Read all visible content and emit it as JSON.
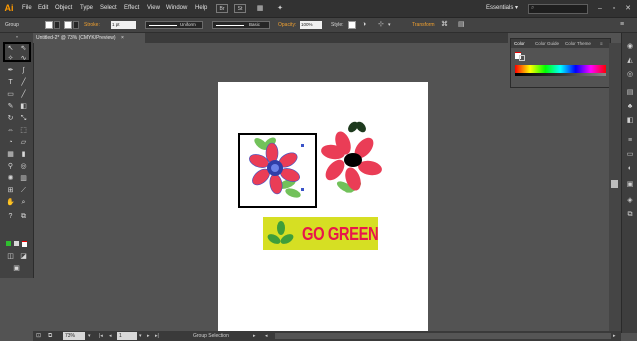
{
  "app": {
    "logo": "Ai"
  },
  "menu": [
    "File",
    "Edit",
    "Object",
    "Type",
    "Select",
    "Effect",
    "View",
    "Window",
    "Help"
  ],
  "menu_icons": {
    "br": "Br",
    "st": "St"
  },
  "workspace": {
    "label": "Essentials",
    "search_placeholder": ""
  },
  "control_bar": {
    "selection": "Group",
    "stroke_label": "Stroke:",
    "stroke_weight": "1 pt",
    "profile": "Uniform",
    "brush": "Basic",
    "opacity_label": "Opacity:",
    "opacity_value": "100%",
    "style_label": "Style:",
    "transform_label": "Transform"
  },
  "document_tab": {
    "title": "Untitled-2* @ 73% (CMYK/Preview)",
    "close": "×"
  },
  "color_panel": {
    "tabs": [
      "Color",
      "Color Guide",
      "Color Theme"
    ]
  },
  "status_bar": {
    "zoom": "73%",
    "page": "1",
    "tool": "Group Selection"
  },
  "artwork": {
    "banner_text": "GO GREEN"
  },
  "colors": {
    "petal": "#ea3d56",
    "leaf": "#72c15a",
    "banner": "#d6df23",
    "banner_text": "#e8164b",
    "flower_center": "#2f3fa8",
    "selection_blue": "#3a53c8"
  }
}
